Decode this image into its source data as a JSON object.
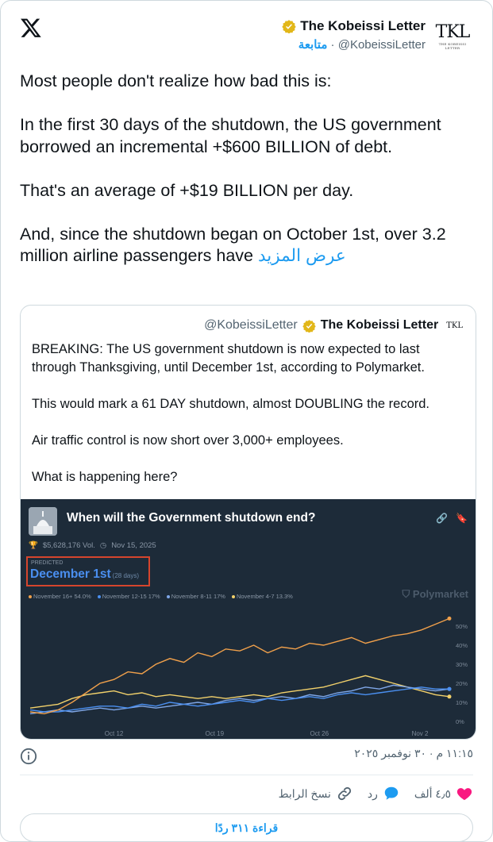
{
  "author": {
    "name": "The Kobeissi Letter",
    "handle": "@KobeissiLetter",
    "follow_label": "متابعة",
    "logo_text": "TKL",
    "logo_subtext": "THE KOBEISSI LETTER"
  },
  "tweet": {
    "paragraphs": [
      "Most people don't realize how bad this is:",
      "In the first 30 days of the shutdown, the US government borrowed an incremental +$600 BILLION of debt.",
      "That's an average of +$19 BILLION per day."
    ],
    "last_paragraph": "And, since the shutdown began on October 1st, over 3.2 million airline passengers have",
    "show_more": "عرض المزيد"
  },
  "quote": {
    "handle": "@KobeissiLetter",
    "name": "The Kobeissi Letter",
    "logo_text": "TKL",
    "paragraphs": [
      "BREAKING: The US government shutdown is now expected to last through Thanksgiving, until December 1st, according to Polymarket.",
      "This would mark a 61 DAY shutdown, almost DOUBLING the record.",
      "Air traffic control is now short over 3,000+ employees.",
      "What is happening here?"
    ]
  },
  "embed": {
    "title": "When will the Government shutdown end?",
    "volume": "$5,628,176 Vol.",
    "date": "Nov 15, 2025",
    "predicted_label": "PREDICTED",
    "predicted_value": "December 1st",
    "predicted_days": "(28 days)",
    "brand": "Polymarket",
    "legend": [
      {
        "label": "November 16+ 54.0%",
        "color": "#f0a04b"
      },
      {
        "label": "November 12-15 17%",
        "color": "#4a8ff0"
      },
      {
        "label": "November 8-11 17%",
        "color": "#7fa7e8"
      },
      {
        "label": "November 4-7 13.3%",
        "color": "#f2d16b"
      }
    ]
  },
  "chart_data": {
    "type": "line",
    "title": "When will the Government shutdown end?",
    "x_ticks": [
      "Oct 12",
      "Oct 19",
      "Oct 26",
      "Nov 2"
    ],
    "y_ticks": [
      "0%",
      "10%",
      "20%",
      "30%",
      "40%",
      "50%"
    ],
    "ylim": [
      0,
      55
    ],
    "grid": false,
    "x": [
      0,
      1,
      2,
      3,
      4,
      5,
      6,
      7,
      8,
      9,
      10,
      11,
      12,
      13,
      14,
      15,
      16,
      17,
      18,
      19,
      20,
      21,
      22,
      23,
      24,
      25,
      26,
      27,
      28,
      29,
      30
    ],
    "series": [
      {
        "name": "November 16+",
        "color": "#f0a04b",
        "values": [
          5,
          4,
          6,
          10,
          15,
          20,
          22,
          26,
          25,
          30,
          33,
          31,
          36,
          34,
          38,
          37,
          40,
          36,
          39,
          38,
          41,
          40,
          42,
          44,
          41,
          43,
          45,
          46,
          48,
          51,
          54
        ]
      },
      {
        "name": "November 12-15",
        "color": "#4a8ff0",
        "values": [
          6,
          5,
          5,
          6,
          7,
          8,
          8,
          7,
          9,
          8,
          10,
          9,
          8,
          9,
          10,
          11,
          10,
          12,
          11,
          12,
          13,
          12,
          14,
          15,
          14,
          15,
          16,
          17,
          18,
          17,
          17
        ]
      },
      {
        "name": "November 8-11",
        "color": "#7fa7e8",
        "values": [
          4,
          5,
          6,
          5,
          6,
          7,
          6,
          7,
          8,
          7,
          8,
          9,
          10,
          9,
          11,
          12,
          11,
          12,
          13,
          12,
          14,
          13,
          15,
          16,
          18,
          17,
          19,
          18,
          17,
          16,
          17
        ]
      },
      {
        "name": "November 4-7",
        "color": "#f2d16b",
        "values": [
          7,
          8,
          9,
          12,
          14,
          15,
          16,
          14,
          15,
          13,
          14,
          13,
          12,
          13,
          12,
          13,
          14,
          13,
          15,
          16,
          17,
          18,
          20,
          22,
          24,
          22,
          20,
          18,
          16,
          14,
          13
        ]
      }
    ]
  },
  "footer": {
    "timestamp": "١١:١٥ م · ٣٠ نوفمبر ٢٠٢٥",
    "likes": "٤٫٥ ألف",
    "reply": "رد",
    "copy_link": "نسخ الرابط",
    "read_replies": "قراءة ٣١١ ردًا"
  }
}
